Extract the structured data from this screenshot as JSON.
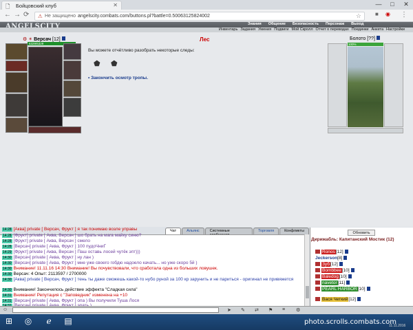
{
  "browser": {
    "tab_title": "Бойцовский клуб",
    "not_secure": "Не защищено",
    "url": "angelscity.combats.com/buttons.pl?battle=0.500631258240​02",
    "controls": [
      "—",
      "□",
      "✕"
    ]
  },
  "header": {
    "logo": "ANGELSCITY",
    "top_links": [
      "Знания",
      "Общение",
      "Безопасность",
      "Персонаж",
      "Выход"
    ],
    "sub_links": [
      "Инвентарь",
      "Задания",
      "Умения",
      "Подвиги",
      "Мой Скролл",
      "Отчет о переводах",
      "Поединки",
      "Анкета",
      "Настройки"
    ]
  },
  "player": {
    "name": "Версач",
    "level": "[12]",
    "hp": "6329/6329"
  },
  "location": {
    "title": "Лес",
    "info": "Вы можете отчётливо разобрать некоторые следы:",
    "finish_link": "Закончить осмотр тропы."
  },
  "place": {
    "name": "Болото",
    "level": "[??]",
    "bar_text": "100%"
  },
  "chat_tabs": [
    "Чат",
    "Альянс",
    "Системные сообщения",
    "Торговля",
    "Конфликты"
  ],
  "chat_lines": [
    {
      "time": "14:28",
      "text": "[Аква] private [ Версач, Фрукт ] я так понимаю возле управы"
    },
    {
      "time": "14:28",
      "text": "[Фрукт] private [ Аква, Версач ] шо брать на мага майку синю?"
    },
    {
      "time": "14:28",
      "text": "[Фрукт] private [ Аква, Версач ] смело"
    },
    {
      "time": "14:28",
      "text": "[Версач] private [ Аква, Фрукт ] 100 пудоЧниГ"
    },
    {
      "time": "14:29",
      "text": "[Фрукт] private [ Аква, Версач ] Паш оставь лосей чутёк эпт)))"
    },
    {
      "time": "14:30",
      "text": "[Версач] private [ Аква, Фрукт ] ну лан )"
    },
    {
      "time": "14:30",
      "text": "[Версач] private [ Аква, Фрукт ] мне уже своего гобдю надоело качать... но уже скоро 5й )"
    },
    {
      "time": "14:30",
      "text": "Внимание! 11.11.16 14:30 Внимание! Вы почувствовали, что сработала одна из больших ловушек."
    },
    {
      "time": "14:30",
      "text": "Версач: 4 Опыт: 2113597 / 2700000"
    },
    {
      "time": "14:30",
      "text": "[Аква] private [ Версач, Фрукт ] тень ты даже сможешь какой-то нубо руной за 100 кр зарунить и не париться - оригинал не привяжется"
    },
    {
      "time": "14:30",
      "text": "Внимание! Закончилось действие эффекта \"Сладкая сила\""
    },
    {
      "time": "14:31",
      "text": "Внимание! Репутация с \"Заповедник\" изменена на +10"
    },
    {
      "time": "14:31",
      "text": "[Версач] private [ Аква, Фрукт ] опа ) Вы получили Туша Лося"
    },
    {
      "time": "14:31",
      "text": "[Версач] private [ Аква, Фрукт ] эпать )"
    }
  ],
  "right_panel": {
    "refresh_label": "Обновить",
    "room_title": "Дирижабль: Капитанский Мостик (12)",
    "players": [
      {
        "name": "Ronos",
        "level": "[12]"
      },
      {
        "name": "Jeckerson",
        "level": "[8]"
      },
      {
        "name": "Зуб",
        "level": "[12]"
      },
      {
        "name": "Bombbee",
        "level": "[10]"
      },
      {
        "name": "Baledog",
        "level": "[10]"
      },
      {
        "name": "navetor",
        "level": "[11]"
      },
      {
        "name": "PEARL HARBOR",
        "level": "[10]"
      },
      {
        "name": "Вася Четкий",
        "level": "[12]"
      }
    ]
  },
  "watermark": "photo.scrolls.combats.com",
  "clock": "11.11.2016"
}
